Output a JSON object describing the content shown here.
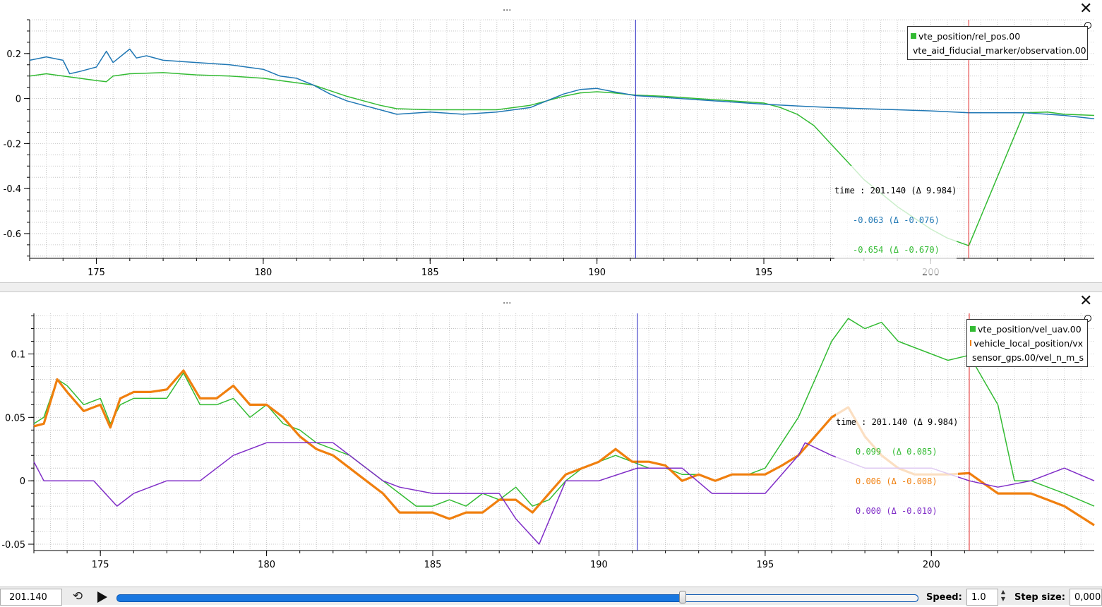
{
  "panels": [
    {
      "header_dots": "...",
      "close_label": "✕",
      "plot": {
        "plotLeft": 42,
        "plotRight": 1550,
        "plotTop": 28,
        "plotBottom": 366,
        "xmin": 173,
        "xmax": 204.9,
        "ymin": -0.71,
        "ymax": 0.35,
        "xticks": [
          175,
          180,
          185,
          190,
          195,
          200
        ],
        "yticks": [
          0.2,
          0,
          -0.2,
          -0.4,
          -0.6
        ],
        "ytick_labels": [
          "0.2",
          "0",
          "-0.2",
          "-0.4",
          "-0.6"
        ],
        "cursor_blue": 191.156,
        "cursor_red": 201.14
      },
      "legend": [
        {
          "label": "vte_position/rel_pos.00",
          "color": "#33bb33"
        },
        {
          "label": "vte_aid_fiducial_marker/observation.00",
          "color": "#1f77b4"
        }
      ],
      "tracker": {
        "time_line": "time : 201.140 (Δ 9.984)",
        "values": [
          {
            "text": "-0.063 (Δ -0.076)",
            "color": "#1f77b4"
          },
          {
            "text": "-0.654 (Δ -0.670)",
            "color": "#33bb33"
          }
        ]
      },
      "chart_data": {
        "type": "line",
        "xlim": [
          173,
          204.9
        ],
        "ylim": [
          -0.71,
          0.35
        ],
        "series": [
          {
            "name": "vte_position/rel_pos.00",
            "color": "#33bb33",
            "x": [
              173,
              173.5,
              174,
              174.5,
              175,
              175.3,
              175.5,
              176,
              177,
              178,
              179,
              180,
              180.5,
              181,
              181.5,
              182,
              182.5,
              183,
              183.5,
              184,
              185,
              186,
              187,
              188,
              188.5,
              189,
              189.5,
              190,
              190.5,
              191.156,
              192,
              193,
              194,
              195,
              195.5,
              196,
              196.5,
              197,
              197.5,
              198,
              198.5,
              199,
              199.5,
              200,
              200.5,
              201.14,
              202.8,
              203.5,
              204,
              204.9
            ],
            "y": [
              0.1,
              0.11,
              0.1,
              0.09,
              0.08,
              0.075,
              0.1,
              0.11,
              0.115,
              0.105,
              0.1,
              0.09,
              0.08,
              0.07,
              0.06,
              0.035,
              0.01,
              -0.01,
              -0.03,
              -0.045,
              -0.05,
              -0.05,
              -0.05,
              -0.03,
              -0.01,
              0.01,
              0.025,
              0.03,
              0.025,
              0.015,
              0.01,
              0.0,
              -0.01,
              -0.02,
              -0.04,
              -0.07,
              -0.12,
              -0.2,
              -0.28,
              -0.36,
              -0.42,
              -0.48,
              -0.53,
              -0.58,
              -0.62,
              -0.654,
              -0.063,
              -0.06,
              -0.07,
              -0.075
            ]
          },
          {
            "name": "vte_aid_fiducial_marker/observation.00",
            "color": "#1f77b4",
            "x": [
              173,
              173.5,
              174,
              174.2,
              174.5,
              175,
              175.3,
              175.5,
              176,
              176.2,
              176.5,
              177,
              178,
              179,
              180,
              180.5,
              181,
              181.5,
              182,
              182.5,
              183,
              183.5,
              184,
              185,
              186,
              187,
              188,
              188.5,
              189,
              189.5,
              190,
              190.5,
              191.156,
              192,
              193,
              194,
              195,
              196,
              197,
              198,
              199,
              200,
              201.14,
              202.8,
              203.5,
              204,
              204.9
            ],
            "y": [
              0.17,
              0.185,
              0.17,
              0.11,
              0.12,
              0.14,
              0.21,
              0.16,
              0.22,
              0.18,
              0.19,
              0.17,
              0.16,
              0.15,
              0.13,
              0.1,
              0.09,
              0.06,
              0.02,
              -0.01,
              -0.03,
              -0.05,
              -0.07,
              -0.06,
              -0.07,
              -0.06,
              -0.04,
              -0.01,
              0.02,
              0.04,
              0.045,
              0.03,
              0.013,
              0.005,
              -0.005,
              -0.015,
              -0.025,
              -0.033,
              -0.04,
              -0.045,
              -0.05,
              -0.055,
              -0.063,
              -0.063,
              -0.07,
              -0.075,
              -0.09
            ]
          }
        ]
      }
    },
    {
      "header_dots": "...",
      "close_label": "✕",
      "plot": {
        "plotLeft": 48,
        "plotRight": 1550,
        "plotTop": 30,
        "plotBottom": 366,
        "xmin": 173,
        "xmax": 204.9,
        "ymin": -0.055,
        "ymax": 0.132,
        "xticks": [
          175,
          180,
          185,
          190,
          195,
          200
        ],
        "yticks": [
          0.1,
          0.05,
          0,
          -0.05
        ],
        "ytick_labels": [
          "0.1",
          "0.05",
          "0",
          "-0.05"
        ],
        "cursor_blue": 191.156,
        "cursor_red": 201.14
      },
      "legend": [
        {
          "label": "vte_position/vel_uav.00",
          "color": "#33bb33"
        },
        {
          "label": "vehicle_local_position/vx",
          "color": "#f07f0e"
        },
        {
          "label": "sensor_gps.00/vel_n_m_s",
          "color": "#7f2cc7"
        }
      ],
      "tracker": {
        "time_line": "time : 201.140 (Δ 9.984)",
        "values": [
          {
            "text": "0.099  (Δ 0.085)",
            "color": "#33bb33"
          },
          {
            "text": "0.006 (Δ -0.008)",
            "color": "#f07f0e"
          },
          {
            "text": "0.000 (Δ -0.010)",
            "color": "#7f2cc7"
          }
        ]
      },
      "chart_data": {
        "type": "line",
        "xlim": [
          173,
          204.9
        ],
        "ylim": [
          -0.055,
          0.132
        ],
        "series": [
          {
            "name": "vte_position/vel_uav.00",
            "color": "#33bb33",
            "x": [
              173,
              173.3,
              173.7,
              174,
              174.5,
              175,
              175.3,
              175.6,
              176,
              176.5,
              177,
              177.5,
              178,
              178.5,
              179,
              179.5,
              180,
              180.5,
              181,
              181.5,
              182,
              182.5,
              183,
              183.5,
              184,
              184.5,
              185,
              185.5,
              186,
              186.5,
              187,
              187.5,
              188,
              188.5,
              189,
              189.5,
              190,
              190.5,
              191,
              191.5,
              192,
              192.5,
              193,
              193.5,
              194,
              194.5,
              195,
              195.5,
              196,
              196.5,
              197,
              197.5,
              198,
              198.5,
              199,
              199.5,
              200,
              200.5,
              201.14,
              202,
              202.5,
              203,
              203.5,
              204,
              204.9
            ],
            "y": [
              0.045,
              0.05,
              0.08,
              0.075,
              0.06,
              0.065,
              0.045,
              0.06,
              0.065,
              0.065,
              0.065,
              0.085,
              0.06,
              0.06,
              0.065,
              0.05,
              0.06,
              0.045,
              0.04,
              0.03,
              0.025,
              0.02,
              0.01,
              0.0,
              -0.01,
              -0.02,
              -0.02,
              -0.015,
              -0.02,
              -0.01,
              -0.015,
              -0.005,
              -0.02,
              -0.015,
              0.0,
              0.01,
              0.015,
              0.02,
              0.015,
              0.01,
              0.01,
              0.005,
              0.005,
              0.0,
              0.005,
              0.005,
              0.01,
              0.03,
              0.05,
              0.08,
              0.11,
              0.128,
              0.12,
              0.125,
              0.11,
              0.105,
              0.1,
              0.095,
              0.099,
              0.06,
              0.0,
              0.0,
              -0.005,
              -0.01,
              -0.02
            ]
          },
          {
            "name": "vehicle_local_position/vx",
            "color": "#f07f0e",
            "x": [
              173,
              173.3,
              173.7,
              174,
              174.5,
              175,
              175.3,
              175.6,
              176,
              176.5,
              177,
              177.5,
              178,
              178.5,
              179,
              179.5,
              180,
              180.5,
              181,
              181.5,
              182,
              182.5,
              183,
              183.5,
              184,
              184.5,
              185,
              185.5,
              186,
              186.5,
              187,
              187.5,
              188,
              188.5,
              189,
              189.5,
              190,
              190.5,
              191,
              191.5,
              192,
              192.5,
              193,
              193.5,
              194,
              194.5,
              195,
              195.5,
              196,
              196.5,
              197,
              197.5,
              198,
              198.5,
              199,
              199.5,
              200,
              200.5,
              201.14,
              202,
              202.5,
              203,
              203.5,
              204,
              204.9
            ],
            "y": [
              0.043,
              0.045,
              0.08,
              0.07,
              0.055,
              0.06,
              0.042,
              0.065,
              0.07,
              0.07,
              0.072,
              0.087,
              0.065,
              0.065,
              0.075,
              0.06,
              0.06,
              0.05,
              0.035,
              0.025,
              0.02,
              0.01,
              0.0,
              -0.01,
              -0.025,
              -0.025,
              -0.025,
              -0.03,
              -0.025,
              -0.025,
              -0.015,
              -0.015,
              -0.025,
              -0.01,
              0.005,
              0.01,
              0.015,
              0.025,
              0.015,
              0.015,
              0.012,
              0.0,
              0.005,
              0.0,
              0.005,
              0.005,
              0.005,
              0.012,
              0.02,
              0.035,
              0.05,
              0.058,
              0.035,
              0.02,
              0.01,
              0.005,
              0.005,
              0.005,
              0.006,
              -0.01,
              -0.01,
              -0.01,
              -0.015,
              -0.02,
              -0.035
            ]
          },
          {
            "name": "sensor_gps.00/vel_n_m_s",
            "color": "#7f2cc7",
            "x": [
              173,
              173.3,
              174,
              174.8,
              175.5,
              176,
              177,
              178,
              179,
              180,
              181,
              182,
              182.5,
              183,
              183.5,
              184,
              185,
              186,
              187,
              187.5,
              188.2,
              189,
              190,
              191.156,
              192,
              192.5,
              193.4,
              194,
              195,
              196,
              196.2,
              197,
              198,
              199,
              200,
              201.14,
              202,
              203,
              204,
              204.9
            ],
            "y": [
              0.015,
              0.0,
              0.0,
              0.0,
              -0.02,
              -0.01,
              0.0,
              0.0,
              0.02,
              0.03,
              0.03,
              0.03,
              0.02,
              0.01,
              0.0,
              -0.005,
              -0.01,
              -0.01,
              -0.01,
              -0.03,
              -0.05,
              0.0,
              0.0,
              0.01,
              0.01,
              0.01,
              -0.01,
              -0.01,
              -0.01,
              0.02,
              0.03,
              0.02,
              0.01,
              0.01,
              0.01,
              0.0,
              -0.005,
              0.0,
              0.01,
              0.0
            ]
          }
        ]
      }
    }
  ],
  "toolbar": {
    "current_time": "201.140",
    "loop_icon": "⟲",
    "slider_fraction": 0.706,
    "speed_label": "Speed:",
    "speed_value": "1.0",
    "step_label": "Step size:",
    "step_value": "0,000"
  }
}
